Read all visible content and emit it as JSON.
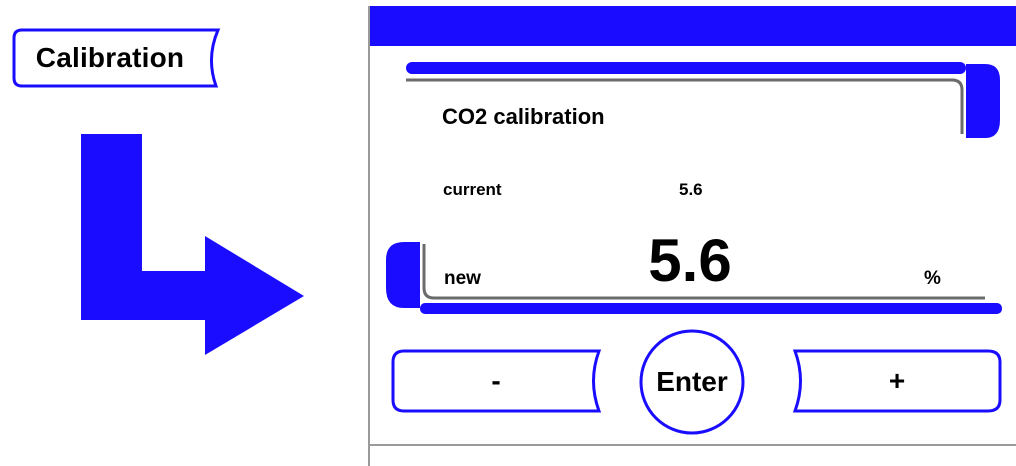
{
  "menu": {
    "calibration_label": "Calibration"
  },
  "screen": {
    "title": "CO2 calibration",
    "current_label": "current",
    "current_value": "5.6",
    "new_label": "new",
    "new_value": "5.6",
    "unit": "%"
  },
  "controls": {
    "minus_label": "-",
    "enter_label": "Enter",
    "plus_label": "+"
  },
  "colors": {
    "accent": "#1a0dff",
    "frame_gray": "#6b6b6b",
    "divider_gray": "#9a9a9a"
  },
  "icons": [
    "arrow-icon"
  ]
}
